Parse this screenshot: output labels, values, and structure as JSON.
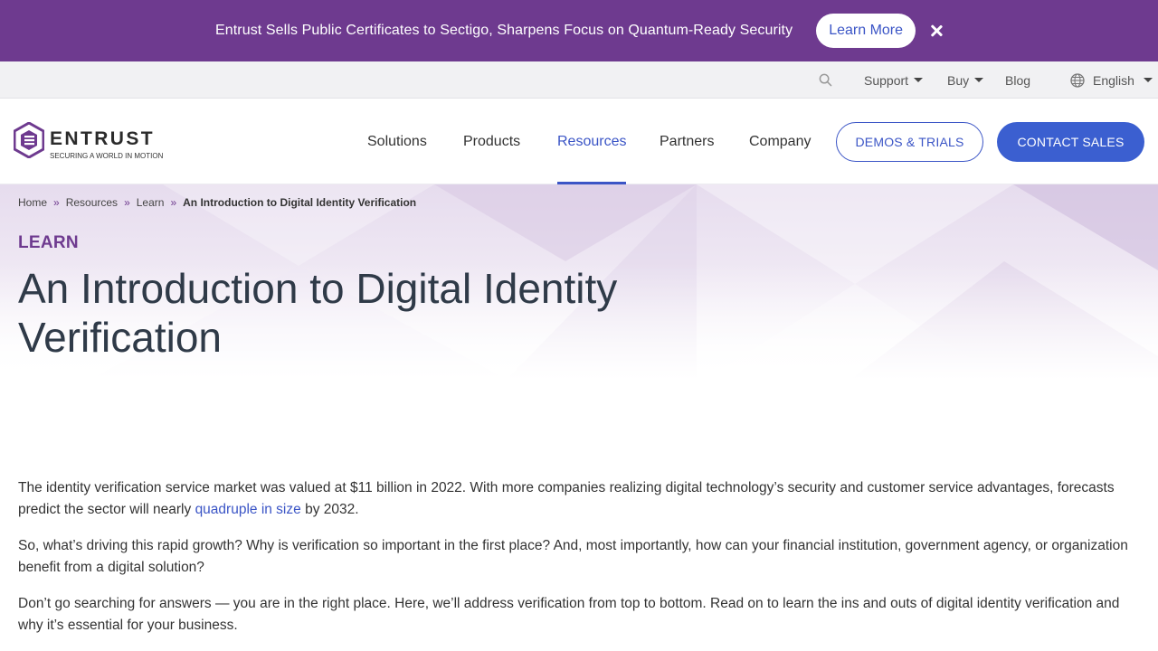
{
  "announcement": {
    "text": "Entrust Sells Public Certificates to Sectigo, Sharpens Focus on Quantum-Ready Security",
    "button_label": "Learn More"
  },
  "utility_nav": {
    "support": "Support",
    "buy": "Buy",
    "blog": "Blog",
    "language": "English"
  },
  "logo": {
    "word": "ENTRUST",
    "tagline": "SECURING A WORLD IN MOTION"
  },
  "main_nav": {
    "items": [
      "Solutions",
      "Products",
      "Resources",
      "Partners",
      "Company"
    ],
    "active": "Resources",
    "demos_button": "DEMOS & TRIALS",
    "contact_button": "CONTACT SALES"
  },
  "breadcrumb": {
    "items": [
      "Home",
      "Resources",
      "Learn"
    ],
    "current": "An Introduction to Digital Identity Verification",
    "separator": "»"
  },
  "hero": {
    "eyebrow": "LEARN",
    "title": "An Introduction to Digital Identity Verification"
  },
  "article": {
    "p1_before": "The identity verification service market was valued at $11 billion in 2022. With more companies realizing digital technology’s security and customer service advantages, forecasts predict the sector will nearly ",
    "p1_link": "quadruple in size",
    "p1_after": " by 2032.",
    "p2": "So, what’s driving this rapid growth? Why is verification so important in the first place? And, most importantly, how can your financial institution, government agency, or organization benefit from a digital solution?",
    "p3": "Don’t go searching for answers — you are in the right place. Here, we’ll address verification from top to bottom. Read on to learn the ins and outs of digital identity verification and why it’s essential for your business."
  },
  "colors": {
    "brand_purple": "#6e3a8f",
    "accent_blue": "#3b55c6"
  }
}
